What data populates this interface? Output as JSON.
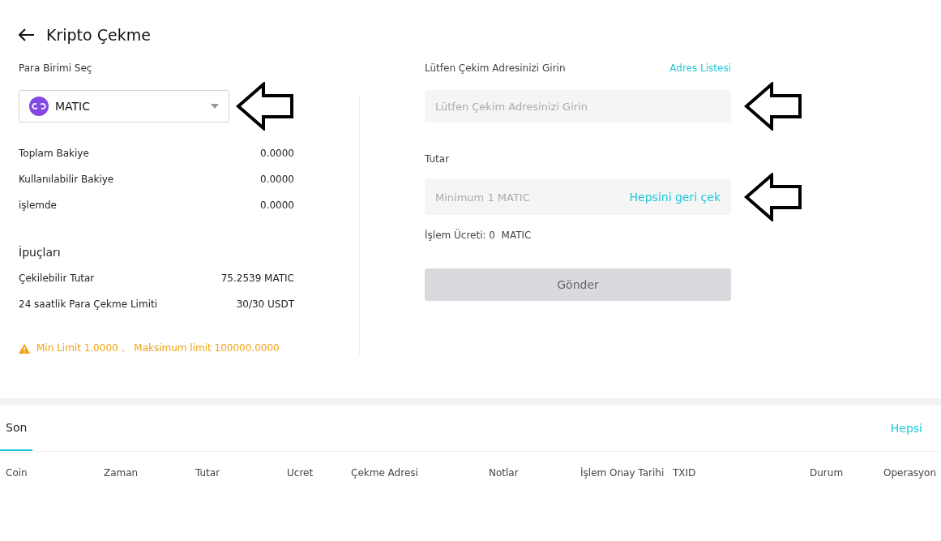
{
  "header": {
    "title": "Kripto Çekme"
  },
  "currency": {
    "label": "Para Birimi Seç",
    "value": "MATIC"
  },
  "balances": [
    {
      "label": "Toplam Bakiye",
      "value": "0.0000"
    },
    {
      "label": "Kullanılabilir Bakiye",
      "value": "0.0000"
    },
    {
      "label": "işlemde",
      "value": "0.0000"
    }
  ],
  "tips": {
    "title": "İpuçları",
    "rows": [
      {
        "label": "Çekilebilir Tutar",
        "value": "75.2539 MATIC"
      },
      {
        "label": "24 saatlik Para Çekme Limiti",
        "value": "30/30 USDT"
      }
    ],
    "warning": "Min Limit 1.0000，  Maksimum limit 100000.0000"
  },
  "address": {
    "label": "Lütfen Çekim Adresinizi Girin",
    "link": "Adres Listesi",
    "placeholder": "Lütfen Çekim Adresinizi Girin"
  },
  "amount": {
    "label": "Tutar",
    "placeholder": "Minimum 1 MATIC",
    "action": "Hepsini geri çek",
    "fee": "İşlem Ücreti: 0  MATIC"
  },
  "submit": {
    "label": "Gönder",
    "disabled": true
  },
  "history": {
    "tabs": [
      {
        "label": "Son",
        "selected": true
      }
    ],
    "link": "Hepsi",
    "columns": [
      "Coin",
      "Zaman",
      "Tutar",
      "Ucret",
      "Çekme Adresi",
      "Notlar",
      "İşlem Onay Tarihi",
      "TXID",
      "Durum",
      "Operasyon"
    ]
  }
}
